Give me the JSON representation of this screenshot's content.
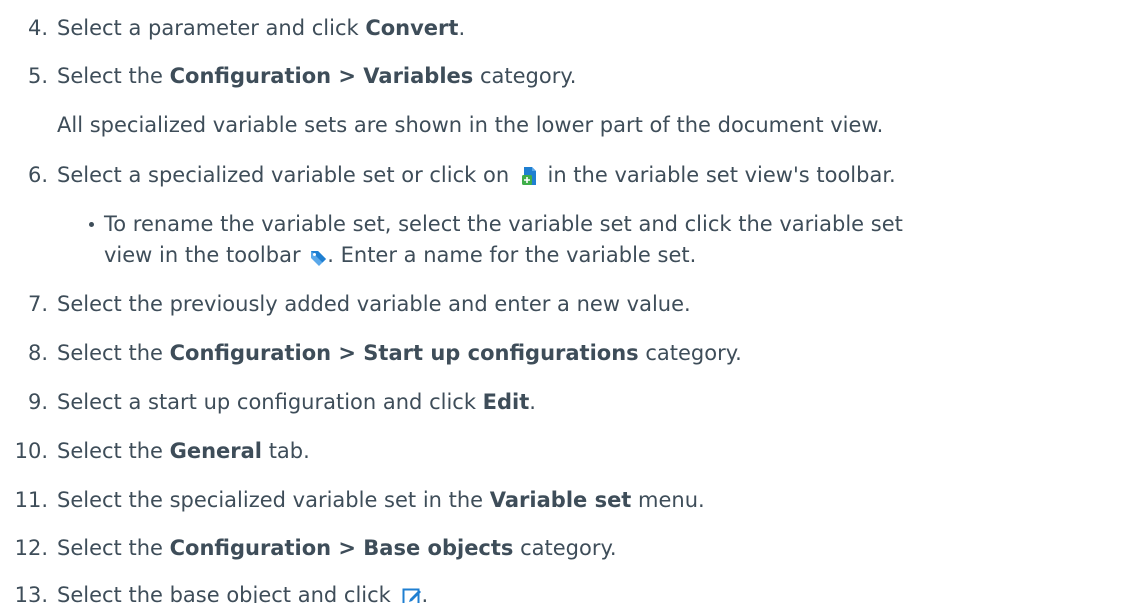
{
  "steps": [
    {
      "num": "4.",
      "t1": "Select a parameter and click ",
      "b1": "Convert",
      "t2": "."
    },
    {
      "num": "5.",
      "t1": "Select the ",
      "b1": "Configuration > Variables",
      "t2": " category."
    },
    {
      "cont": "All specialized variable sets are shown in the lower part of the document view."
    },
    {
      "num": "6.",
      "t1": "Select a specialized variable set or click on ",
      "icon": "new-variable-set-icon",
      "t2": " in the variable set view's toolbar."
    },
    {
      "bullet1": "To rename the variable set, select the variable set and click the variable set",
      "bullet2a": "view in the toolbar ",
      "icon": "tag-icon",
      "bullet2b": ". Enter a name for the variable set."
    },
    {
      "num": "7.",
      "t1": "Select the previously added variable and enter a new value."
    },
    {
      "num": "8.",
      "t1": "Select the ",
      "b1": "Configuration > Start up configurations",
      "t2": " category."
    },
    {
      "num": "9.",
      "t1": "Select a start up configuration and click ",
      "b1": "Edit",
      "t2": "."
    },
    {
      "num": "10.",
      "t1": "Select the ",
      "b1": "General",
      "t2": " tab."
    },
    {
      "num": "11.",
      "t1": "Select the specialized variable set in the ",
      "b1": "Variable set",
      "t2": " menu."
    },
    {
      "num": "12.",
      "t1": "Select the ",
      "b1": "Configuration > Base objects",
      "t2": " category."
    },
    {
      "num": "13.",
      "t1": "Select the base object and click ",
      "icon": "edit-icon",
      "t2": "."
    }
  ],
  "colors": {
    "text": "#3e4d59",
    "icon_blue": "#1f7fd1",
    "icon_green": "#3fae49"
  }
}
